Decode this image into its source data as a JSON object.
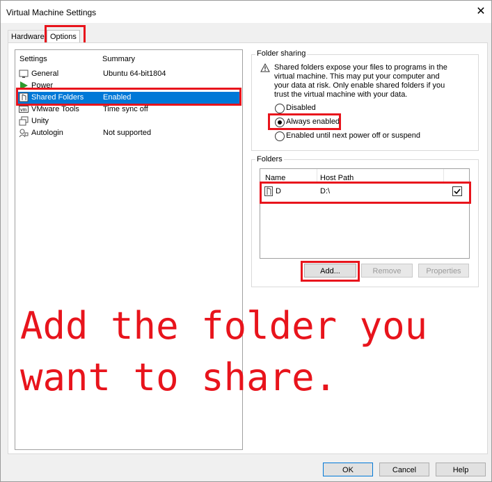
{
  "window": {
    "title": "Virtual Machine Settings",
    "close_glyph": "✕"
  },
  "tabs": [
    {
      "label": "Hardware"
    },
    {
      "label": "Options"
    }
  ],
  "settings_list": {
    "header_settings": "Settings",
    "header_summary": "Summary",
    "items": [
      {
        "icon": "general-icon",
        "label": "General",
        "summary": "Ubuntu 64-bit1804"
      },
      {
        "icon": "power-icon",
        "label": "Power",
        "summary": ""
      },
      {
        "icon": "shared-folders-icon",
        "label": "Shared Folders",
        "summary": "Enabled"
      },
      {
        "icon": "vmware-tools-icon",
        "label": "VMware Tools",
        "summary": "Time sync off"
      },
      {
        "icon": "unity-icon",
        "label": "Unity",
        "summary": ""
      },
      {
        "icon": "autologin-icon",
        "label": "Autologin",
        "summary": "Not supported"
      }
    ]
  },
  "folder_sharing": {
    "group_label": "Folder sharing",
    "warning": "Shared folders expose your files to programs in the virtual machine. This may put your computer and your data at risk. Only enable shared folders if you trust the virtual machine with your data.",
    "options": [
      {
        "label": "Disabled",
        "selected": false
      },
      {
        "label": "Always enabled",
        "selected": true
      },
      {
        "label": "Enabled until next power off or suspend",
        "selected": false
      }
    ]
  },
  "folders": {
    "group_label": "Folders",
    "col_name": "Name",
    "col_host_path": "Host Path",
    "rows": [
      {
        "name": "D",
        "host_path": "D:\\",
        "enabled": true
      }
    ],
    "buttons": {
      "add": "Add...",
      "remove": "Remove",
      "properties": "Properties"
    }
  },
  "annotation": {
    "line1": "Add the folder you",
    "line2": "want to share."
  },
  "footer": {
    "ok": "OK",
    "cancel": "Cancel",
    "help": "Help"
  },
  "colors": {
    "highlight": "#0078d7",
    "annotation_red": "#e8141c"
  }
}
